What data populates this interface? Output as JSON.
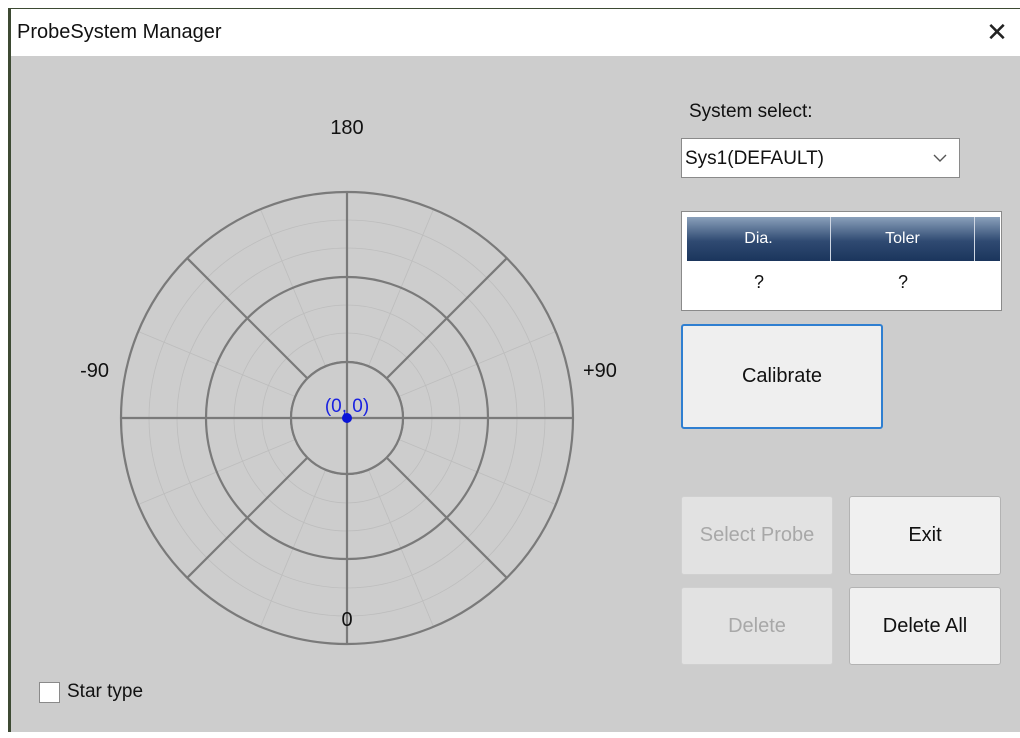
{
  "window": {
    "title": "ProbeSystem Manager",
    "close_icon": "close-icon",
    "close_glyph": "✕"
  },
  "polar": {
    "labels": {
      "top": "180",
      "bottom": "0",
      "left": "-90",
      "right": "+90"
    },
    "point_label": "(0, 0)",
    "point_color": "#0a14d8"
  },
  "system": {
    "label": "System select:",
    "selected": "Sys1(DEFAULT)"
  },
  "table": {
    "headers": [
      "Dia.",
      "Toler"
    ],
    "rows": [
      [
        "?",
        "?"
      ]
    ]
  },
  "buttons": {
    "calibrate": "Calibrate",
    "select_probe": "Select Probe",
    "exit": "Exit",
    "delete": "Delete",
    "delete_all": "Delete All"
  },
  "options": {
    "star_type": "Star type",
    "star_type_checked": false
  },
  "colors": {
    "accent": "#2f7fd1",
    "header_dark": "#1b355c",
    "panel": "#cdcdcd"
  }
}
